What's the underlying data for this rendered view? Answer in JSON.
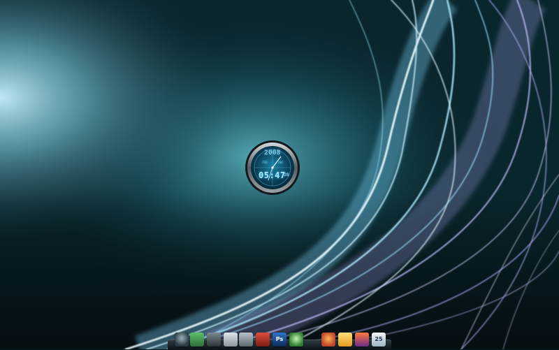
{
  "clock": {
    "year": "2008",
    "time": "05:47",
    "date": "28",
    "mini_left": "FEB",
    "mini_right": "THU"
  },
  "dock": {
    "items": [
      {
        "name": "start-orb-icon",
        "glyph": ""
      },
      {
        "name": "files-icon",
        "glyph": ""
      },
      {
        "name": "folder-icon",
        "glyph": ""
      },
      {
        "name": "documents-icon",
        "glyph": ""
      },
      {
        "name": "recycle-bin-icon",
        "glyph": ""
      },
      {
        "name": "media-icon",
        "glyph": ""
      },
      {
        "name": "photoshop-icon",
        "glyph": "Ps"
      },
      {
        "name": "hand-icon",
        "glyph": ""
      },
      {
        "name": "browser-icon",
        "glyph": ""
      },
      {
        "name": "mail-icon",
        "glyph": ""
      },
      {
        "name": "tools-icon",
        "glyph": ""
      },
      {
        "name": "calendar-icon",
        "glyph": "25"
      }
    ]
  },
  "colors": {
    "accent_cyan": "#3cc8ff",
    "wallpaper_dark": "#061a20",
    "streak_light": "#d9f6ff",
    "streak_violet": "#b9b0ff"
  }
}
